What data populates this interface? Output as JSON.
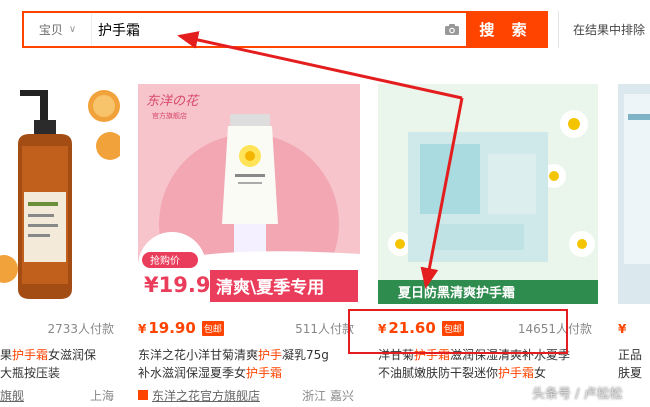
{
  "search": {
    "scope_label": "宝贝",
    "query": "护手霜",
    "button_label": "搜 索",
    "in_result_label": "在结果中排除"
  },
  "products": [
    {
      "price_int": "",
      "sold": "2733人付款",
      "title_pre": "果",
      "title_hl": "护手霜",
      "title_post": "女滋润保",
      "title_line2": "大瓶按压装",
      "shop": "旗舰",
      "location": "上海"
    },
    {
      "price": "19.90",
      "price_symbol": "¥",
      "baoyou": "包邮",
      "sold": "511人付款",
      "title_pre": "东洋之花小洋甘菊清爽",
      "title_hl": "护手",
      "title_post": "凝乳75g",
      "title_line2_pre": "补水滋润保湿夏季女",
      "title_line2_hl": "护手霜",
      "shop": "东洋之花官方旗舰店",
      "location": "浙江 嘉兴",
      "image": {
        "brand": "东洋の花",
        "brand_sub": "官方旗舰店",
        "badge": "抢购价",
        "banner_price": "¥19.9",
        "banner_text": "清爽\\夏季专用"
      }
    },
    {
      "price": "21.60",
      "price_symbol": "¥",
      "baoyou": "包邮",
      "sold": "14651人付款",
      "title_pre": "洋甘菊",
      "title_hl": "护手霜",
      "title_post": "滋润保湿清爽补水夏季",
      "title_line2_pre": "不油腻嫩肤防干裂迷你",
      "title_line2_hl": "护手霜",
      "title_line2_post": "女",
      "image": {
        "banner_text": "夏日防黑清爽护手霜"
      }
    },
    {
      "price_symbol": "¥",
      "title_line1": "正品",
      "title_line2": "肤夏"
    }
  ],
  "watermark": "头条号 / 卢松松",
  "colors": {
    "accent": "#ff4400",
    "annotation": "#e41e1e"
  }
}
